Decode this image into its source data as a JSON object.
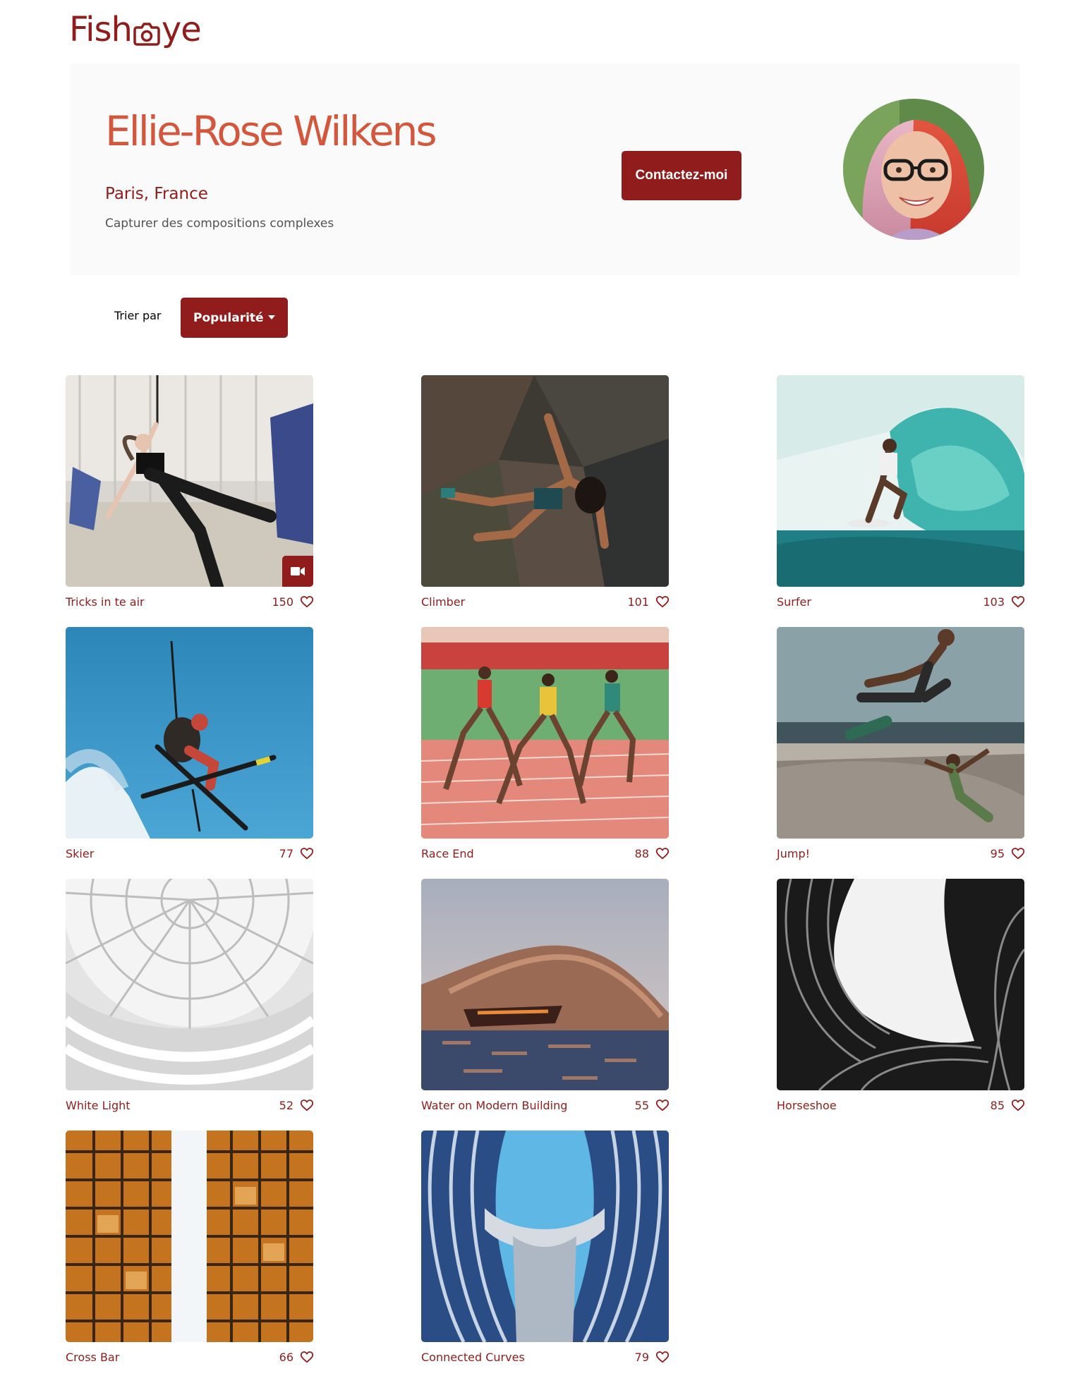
{
  "brand": {
    "logo_left": "Fish",
    "logo_icon": "camera-icon",
    "logo_right": "ye"
  },
  "profile": {
    "name": "Ellie-Rose Wilkens",
    "location": "Paris, France",
    "tagline": "Capturer des compositions complexes",
    "contact_label": "Contactez-moi",
    "avatar_icon": "portrait-avatar"
  },
  "sort": {
    "label": "Trier par",
    "selected": "Popularité"
  },
  "colors": {
    "brand": "#901c1c",
    "name_accent": "#d3573c",
    "banner_bg": "#fafafa"
  },
  "media": [
    {
      "title": "Tricks in te air",
      "likes": "150",
      "video": true
    },
    {
      "title": "Climber",
      "likes": "101",
      "video": false
    },
    {
      "title": "Surfer",
      "likes": "103",
      "video": false
    },
    {
      "title": "Skier",
      "likes": "77",
      "video": false
    },
    {
      "title": "Race End",
      "likes": "88",
      "video": false
    },
    {
      "title": "Jump!",
      "likes": "95",
      "video": false
    },
    {
      "title": "White Light",
      "likes": "52",
      "video": false
    },
    {
      "title": "Water on Modern Building",
      "likes": "55",
      "video": false
    },
    {
      "title": "Horseshoe",
      "likes": "85",
      "video": false
    },
    {
      "title": "Cross Bar",
      "likes": "66",
      "video": false
    },
    {
      "title": "Connected Curves",
      "likes": "79",
      "video": false
    }
  ]
}
